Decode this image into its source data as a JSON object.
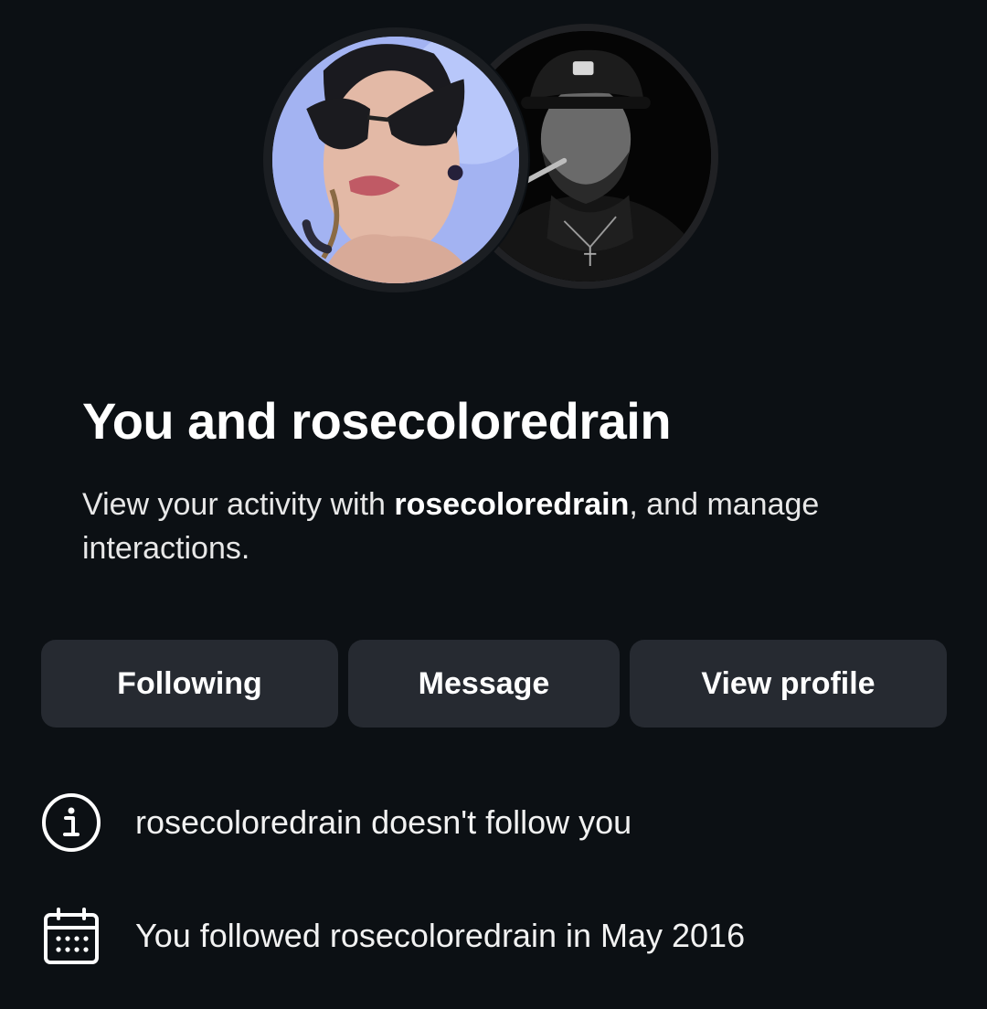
{
  "avatars": [
    {
      "name": "profile-avatar-you",
      "description_icon": "avatar-photo"
    },
    {
      "name": "profile-avatar-rosecoloredrain",
      "description_icon": "avatar-photo"
    }
  ],
  "header": {
    "title": "You and rosecoloredrain"
  },
  "subtitle": {
    "prefix": "View your activity with ",
    "username": "rosecoloredrain",
    "suffix": ", and manage interactions."
  },
  "actions": {
    "following_label": "Following",
    "message_label": "Message",
    "view_profile_label": "View profile"
  },
  "info": [
    {
      "icon": "info-icon",
      "text": "rosecoloredrain doesn't follow you"
    },
    {
      "icon": "calendar-icon",
      "text": "You followed rosecoloredrain in May 2016"
    }
  ],
  "colors": {
    "background": "#0c1014",
    "button_bg": "#262a31",
    "text_primary": "#ffffff"
  }
}
